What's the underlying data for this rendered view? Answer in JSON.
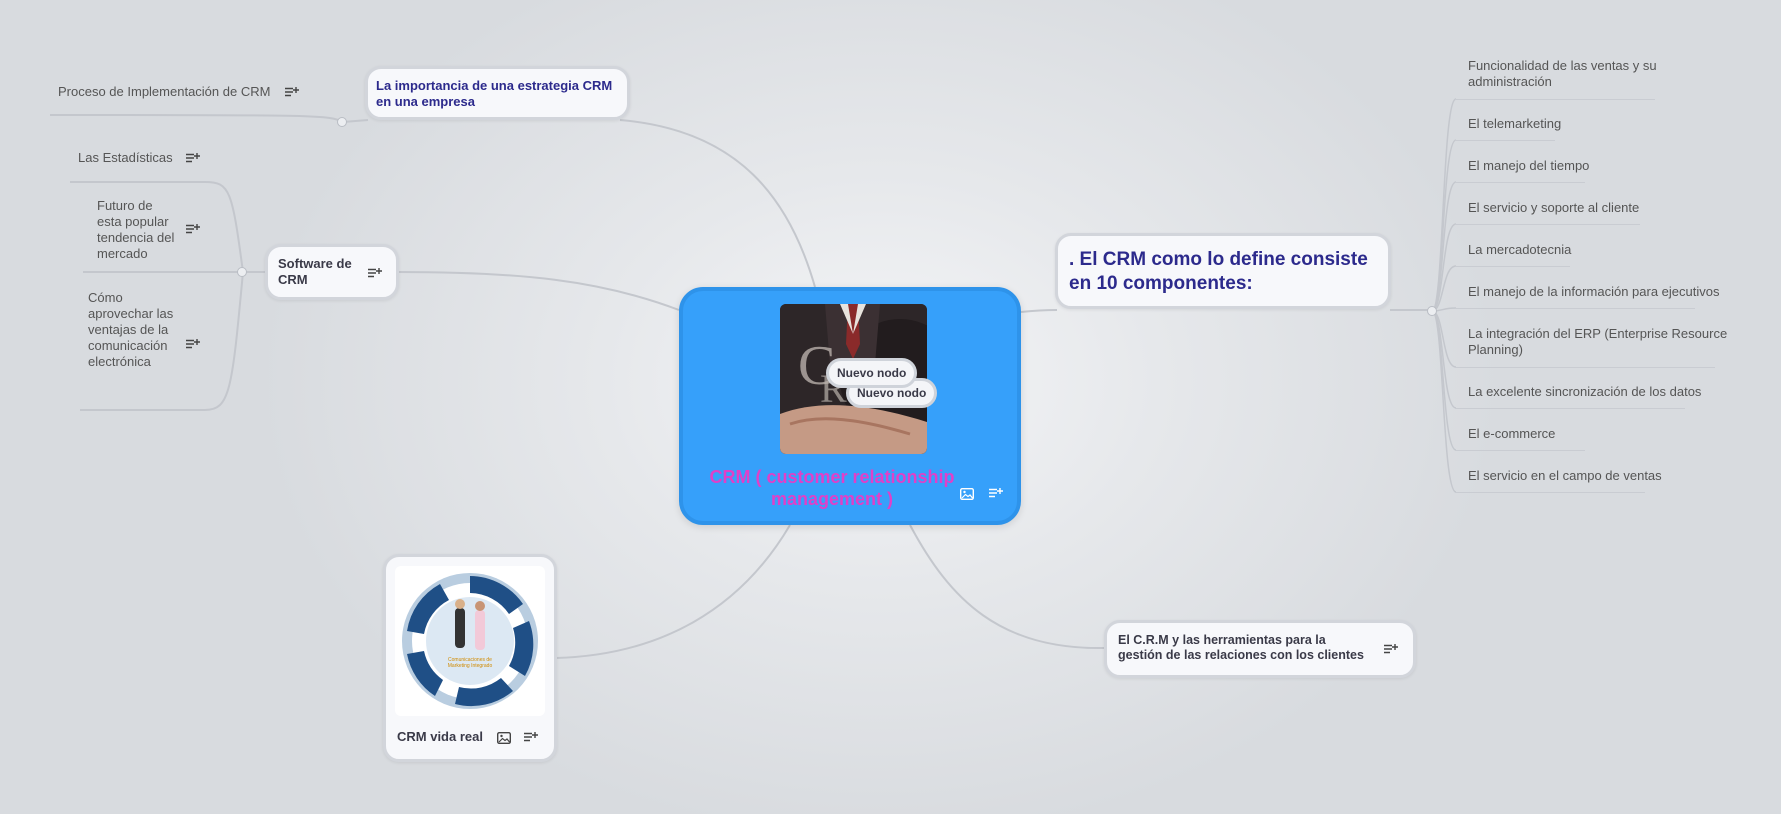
{
  "central": {
    "title": "CRM ( customer relationship management )",
    "bubbles": [
      "Nuevo nodo",
      "Nuevo nodo"
    ],
    "color": "#36a0fa",
    "title_color": "#e040c8",
    "image": "crm-businessman-photo"
  },
  "topics": {
    "importancia": "La importancia de una estrategia CRM en una empresa",
    "software": "Software de CRM",
    "componentes": ". El CRM como lo define consiste en 10 componentes:",
    "herramientas": "El C.R.M y las herramientas para la gestión de las relaciones con los clientes",
    "vida_real": "CRM vida real"
  },
  "left_leaves": {
    "proceso": "Proceso de Implementación de CRM",
    "estadisticas": "Las Estadísticas",
    "futuro": "Futuro de esta popular tendencia del mercado",
    "aprovechar": "Cómo aprovechar las ventajas de la comunicación electrónica"
  },
  "componentes_items": [
    "Funcionalidad de las ventas y su administración",
    "El telemarketing",
    "El manejo del tiempo",
    "El servicio y soporte al cliente",
    "La mercadotecnia",
    "El manejo de la información para ejecutivos",
    "La integración del ERP (Enterprise Resource Planning)",
    "La excelente sincronización de los datos",
    "El e-commerce",
    "El servicio en el campo de ventas"
  ],
  "icons": {
    "note": "note-add-icon",
    "image": "image-icon"
  },
  "colors": {
    "topic_text_blue": "#2c2a8c",
    "topic_text_dark": "#3a3a48",
    "branch": "#c4c7cd"
  }
}
